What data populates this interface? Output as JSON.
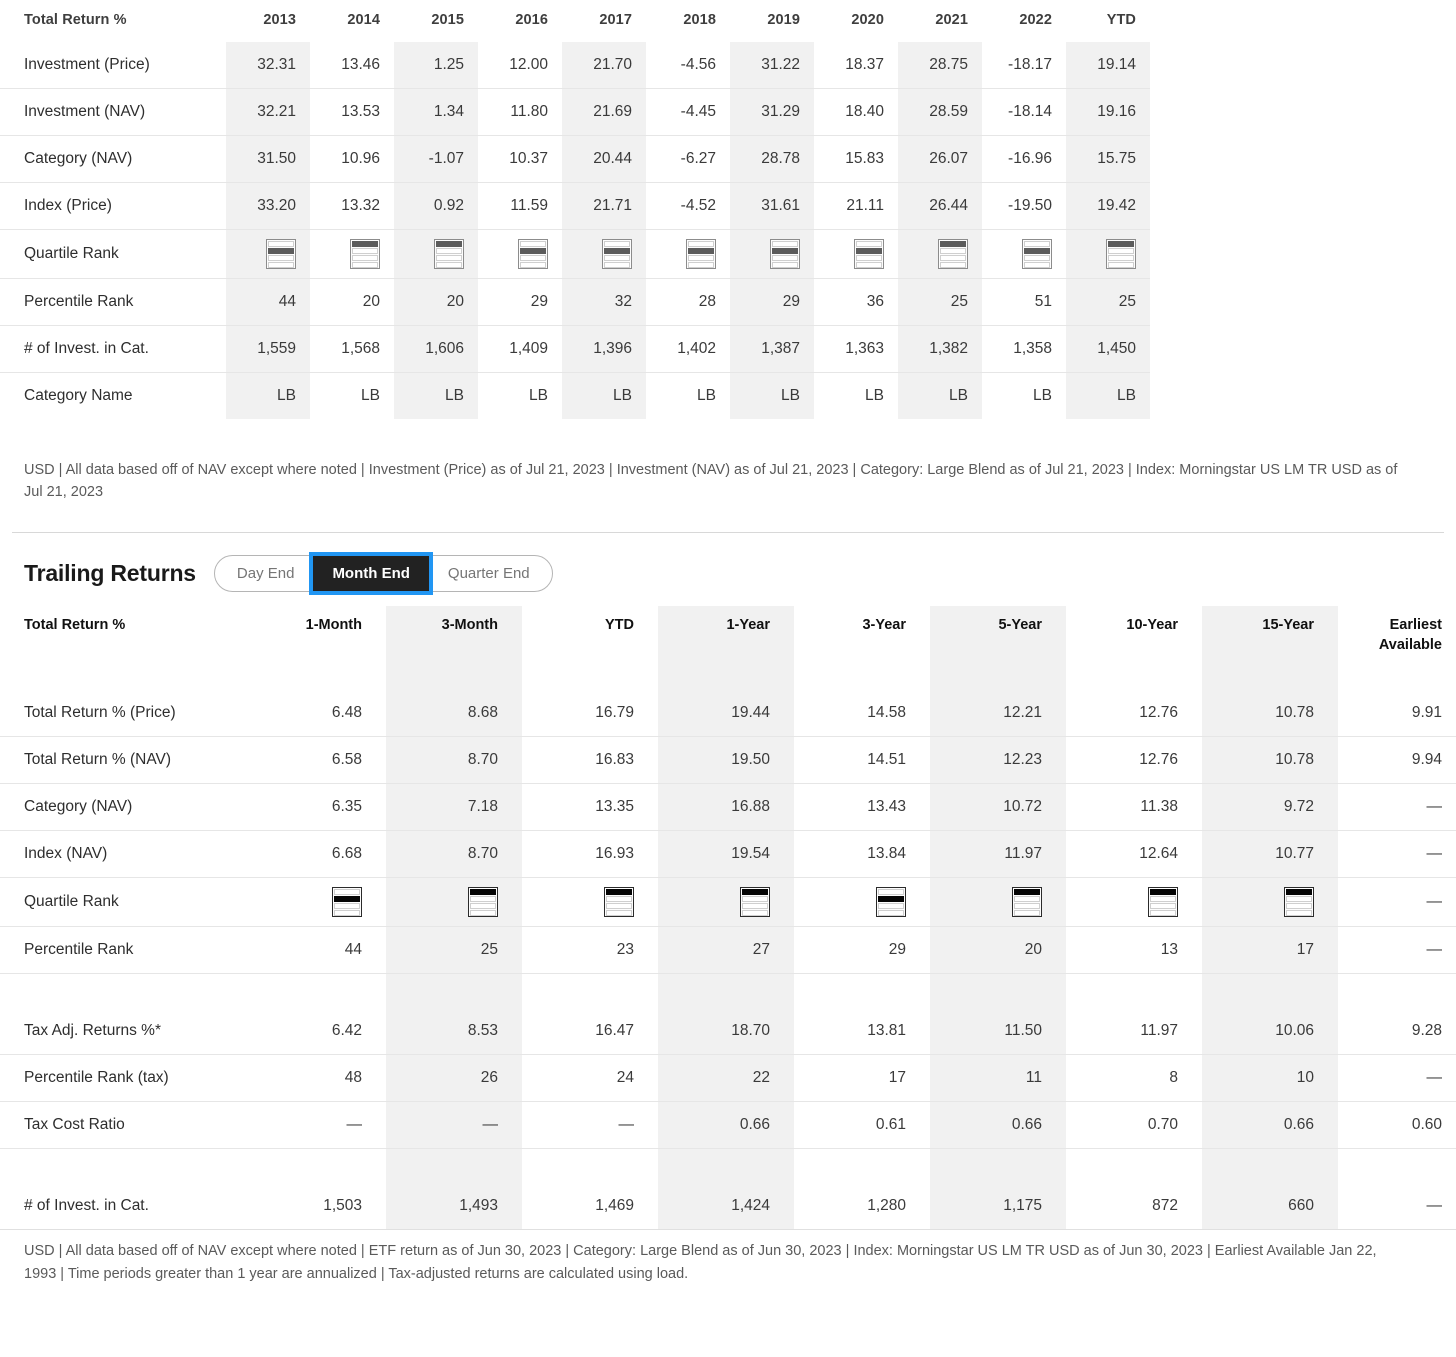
{
  "annual_table": {
    "row_header_label": "Total Return %",
    "columns": [
      "2013",
      "2014",
      "2015",
      "2016",
      "2017",
      "2018",
      "2019",
      "2020",
      "2021",
      "2022",
      "YTD"
    ],
    "rows": [
      {
        "label": "Investment (Price)",
        "values": [
          "32.31",
          "13.46",
          "1.25",
          "12.00",
          "21.70",
          "-4.56",
          "31.22",
          "18.37",
          "28.75",
          "-18.17",
          "19.14"
        ]
      },
      {
        "label": "Investment (NAV)",
        "values": [
          "32.21",
          "13.53",
          "1.34",
          "11.80",
          "21.69",
          "-4.45",
          "31.29",
          "18.40",
          "28.59",
          "-18.14",
          "19.16"
        ]
      },
      {
        "label": "Category (NAV)",
        "values": [
          "31.50",
          "10.96",
          "-1.07",
          "10.37",
          "20.44",
          "-6.27",
          "28.78",
          "15.83",
          "26.07",
          "-16.96",
          "15.75"
        ]
      },
      {
        "label": "Index (Price)",
        "values": [
          "33.20",
          "13.32",
          "0.92",
          "11.59",
          "21.71",
          "-4.52",
          "31.61",
          "21.11",
          "26.44",
          "-19.50",
          "19.42"
        ]
      }
    ],
    "quartile_row": {
      "label": "Quartile Rank",
      "icon_name": "quartile-rank-icon",
      "values": [
        2,
        1,
        1,
        2,
        2,
        2,
        2,
        2,
        1,
        2,
        1
      ]
    },
    "percentile_row": {
      "label": "Percentile Rank",
      "values": [
        "44",
        "20",
        "20",
        "29",
        "32",
        "28",
        "29",
        "36",
        "25",
        "51",
        "25"
      ]
    },
    "count_row": {
      "label": "# of Invest. in Cat.",
      "values": [
        "1,559",
        "1,568",
        "1,606",
        "1,409",
        "1,396",
        "1,402",
        "1,387",
        "1,363",
        "1,382",
        "1,358",
        "1,450"
      ]
    },
    "category_row": {
      "label": "Category Name",
      "values": [
        "LB",
        "LB",
        "LB",
        "LB",
        "LB",
        "LB",
        "LB",
        "LB",
        "LB",
        "LB",
        "LB"
      ]
    }
  },
  "footnote_top": "USD | All data based off of NAV except where noted  | Investment (Price) as of Jul 21, 2023  | Investment (NAV) as of Jul 21, 2023 | Category: Large Blend as of Jul 21, 2023 | Index: Morningstar US LM TR USD as of Jul 21, 2023",
  "trailing": {
    "title": "Trailing Returns",
    "toggle": {
      "options": [
        "Day End",
        "Month End",
        "Quarter End"
      ],
      "active": "Month End"
    },
    "row_header_label": "Total Return %",
    "columns": [
      "1-Month",
      "3-Month",
      "YTD",
      "1-Year",
      "3-Year",
      "5-Year",
      "10-Year",
      "15-Year",
      "Earliest\nAvailable"
    ],
    "column_last_line1": "Earliest",
    "column_last_line2": "Available",
    "rows": [
      {
        "label": "Total Return % (Price)",
        "values": [
          "6.48",
          "8.68",
          "16.79",
          "19.44",
          "14.58",
          "12.21",
          "12.76",
          "10.78",
          "9.91"
        ]
      },
      {
        "label": "Total Return % (NAV)",
        "values": [
          "6.58",
          "8.70",
          "16.83",
          "19.50",
          "14.51",
          "12.23",
          "12.76",
          "10.78",
          "9.94"
        ]
      },
      {
        "label": "Category (NAV)",
        "values": [
          "6.35",
          "7.18",
          "13.35",
          "16.88",
          "13.43",
          "10.72",
          "11.38",
          "9.72",
          "—"
        ]
      },
      {
        "label": "Index (NAV)",
        "values": [
          "6.68",
          "8.70",
          "16.93",
          "19.54",
          "13.84",
          "11.97",
          "12.64",
          "10.77",
          "—"
        ]
      }
    ],
    "quartile_row": {
      "label": "Quartile Rank",
      "icon_name": "quartile-rank-icon",
      "values": [
        2,
        1,
        1,
        1,
        2,
        1,
        1,
        1
      ],
      "last_value": "—"
    },
    "percentile_row": {
      "label": "Percentile Rank",
      "values": [
        "44",
        "25",
        "23",
        "27",
        "29",
        "20",
        "13",
        "17",
        "—"
      ]
    },
    "tax_adj_row": {
      "label": "Tax Adj. Returns %*",
      "values": [
        "6.42",
        "8.53",
        "16.47",
        "18.70",
        "13.81",
        "11.50",
        "11.97",
        "10.06",
        "9.28"
      ]
    },
    "percentile_tax_row": {
      "label": "Percentile Rank (tax)",
      "values": [
        "48",
        "26",
        "24",
        "22",
        "17",
        "11",
        "8",
        "10",
        "—"
      ]
    },
    "tax_cost_row": {
      "label": "Tax Cost Ratio",
      "values": [
        "—",
        "—",
        "—",
        "0.66",
        "0.61",
        "0.66",
        "0.70",
        "0.66",
        "0.60"
      ]
    },
    "count_row": {
      "label": "# of Invest. in Cat.",
      "values": [
        "1,503",
        "1,493",
        "1,469",
        "1,424",
        "1,280",
        "1,175",
        "872",
        "660",
        "—"
      ]
    }
  },
  "footnote_bottom_line1": "USD | All data based off of NAV except where noted | ETF return as of Jun 30, 2023 | Category: Large Blend as of Jun 30, 2023 | Index: Morningstar US LM TR USD as of Jun 30, 2023 |",
  "footnote_bottom_line2": "Earliest Available Jan 22, 1993 | Time periods greater than 1 year are annualized | Tax-adjusted returns are calculated using load.",
  "colors": {
    "shade": "#f1f1f1",
    "rule": "#e6e6e6",
    "active_toggle_bg": "#222222",
    "focus_ring": "#2196f3",
    "text": "#3a3a3a"
  }
}
